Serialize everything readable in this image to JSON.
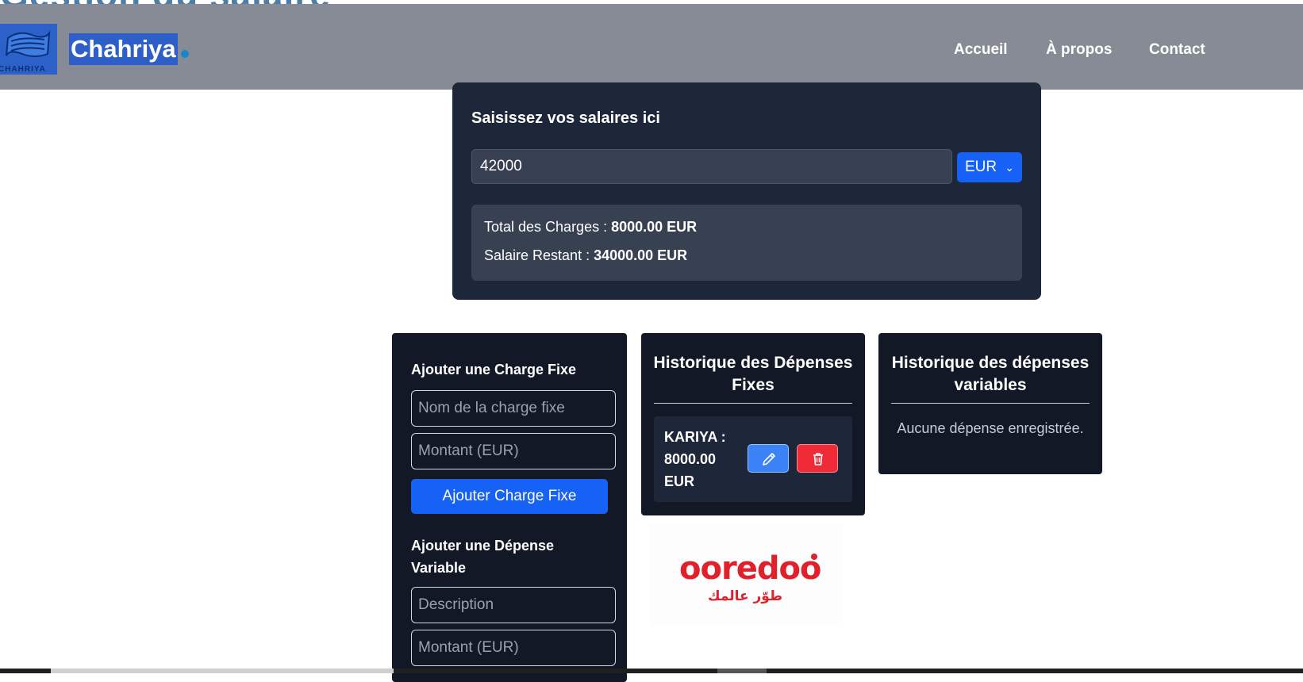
{
  "background_heading": "Gestion du salaire",
  "header": {
    "logo_text": "CHAHRIYA",
    "brand": "Chahriya",
    "nav": [
      {
        "label": "Accueil"
      },
      {
        "label": "À propos"
      },
      {
        "label": "Contact"
      }
    ]
  },
  "salary": {
    "title": "Saisissez vos salaires ici",
    "input_value": "42000",
    "currency": "EUR",
    "total_label": "Total des Charges :",
    "total_value": "8000.00 EUR",
    "remaining_label": "Salaire Restant :",
    "remaining_value": "34000.00 EUR"
  },
  "form": {
    "fixed_title": "Ajouter une Charge Fixe",
    "fixed_name_placeholder": "Nom de la charge fixe",
    "fixed_amount_placeholder": "Montant (EUR)",
    "fixed_button": "Ajouter Charge Fixe",
    "variable_title": "Ajouter une Dépense Variable",
    "variable_desc_placeholder": "Description",
    "variable_amount_placeholder": "Montant (EUR)"
  },
  "fixed_history": {
    "title": "Historique des Dépenses Fixes",
    "items": [
      {
        "label": "KARIYA : 8000.00 EUR"
      }
    ]
  },
  "variable_history": {
    "title": "Historique des dépenses variables",
    "empty_text": "Aucune dépense enregistrée."
  },
  "ad": {
    "brand": "ooredoo",
    "tagline": "طوّر عالمك"
  },
  "colors": {
    "header_bg": "#878b95",
    "card_bg": "#1e2739",
    "panel_bg": "#121826",
    "accent": "#1661f6",
    "danger": "#ef2b38"
  }
}
